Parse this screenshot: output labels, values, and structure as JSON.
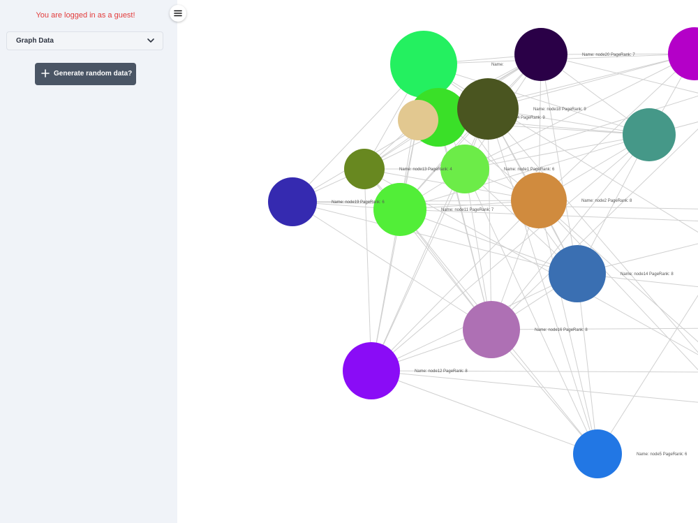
{
  "sidebar": {
    "guest_message": "You are logged in as a guest!",
    "graph_select": {
      "selected": "Graph Data",
      "icon": "chevron-down-icon"
    },
    "generate_button": {
      "label": "Generate random data?",
      "icon": "plus-icon"
    },
    "menu_toggle_icon": "hamburger-menu-icon"
  },
  "graph": {
    "edge_color": "#d0d0d0",
    "nodes": [
      {
        "id": "node-a",
        "label": "",
        "color": "#24f060"
      },
      {
        "id": "node20",
        "label": "Name: node20 PageRank: 7",
        "color": "#2a0047"
      },
      {
        "id": "node-m",
        "label": "",
        "color": "#b400c8"
      },
      {
        "id": "node-g",
        "label": "",
        "color": "#3ae028"
      },
      {
        "id": "node-t",
        "label": "",
        "color": "#e2c890"
      },
      {
        "id": "node18",
        "label": "Name: node18 PageRank: 9",
        "color": "#4a5520"
      },
      {
        "id": "node-teal",
        "label": "",
        "color": "#459888"
      },
      {
        "id": "node13",
        "label": "Name: node13 PageRank: 4",
        "color": "#688820"
      },
      {
        "id": "node1",
        "label": "Name: node1 PageRank: 6",
        "color": "#6cec48"
      },
      {
        "id": "node19",
        "label": "Name: node19 PageRank: 6",
        "color": "#352ab0"
      },
      {
        "id": "node11",
        "label": "Name: node11 PageRank: 7",
        "color": "#52ee38"
      },
      {
        "id": "node2",
        "label": "Name: node2 PageRank: 8",
        "color": "#d08b3e"
      },
      {
        "id": "node14",
        "label": "Name: node14 PageRank: 8",
        "color": "#3a6fb2"
      },
      {
        "id": "node16",
        "label": "Name: node16 PageRank: 8",
        "color": "#ae70b4"
      },
      {
        "id": "node12",
        "label": "Name: node12 PageRank: 8",
        "color": "#8a0cf6"
      },
      {
        "id": "node5",
        "label": "Name: node5 PageRank: 6",
        "color": "#2277e4"
      }
    ],
    "partial_labels": [
      {
        "text": "Name: ",
        "near": "node-a"
      },
      {
        "text": "Name: ",
        "near": "node-g"
      },
      {
        "text": "4 PageRank: 9",
        "near": "node18"
      }
    ]
  }
}
